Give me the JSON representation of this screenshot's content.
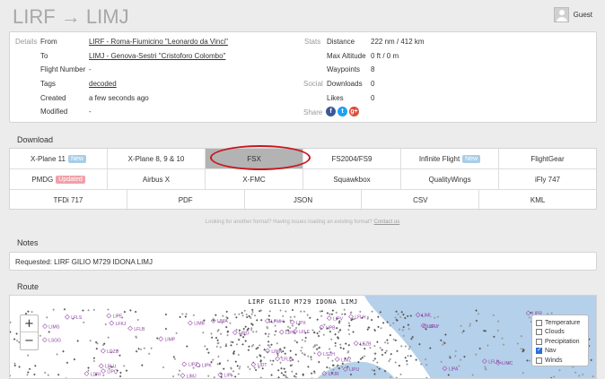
{
  "header": {
    "title": "LIRF → LIMJ",
    "user": "Guest"
  },
  "details": {
    "section": "Details",
    "from_label": "From",
    "from_value": "LIRF - Roma-Fiumicino \"Leonardo da Vinci\"",
    "to_label": "To",
    "to_value": "LIMJ - Genova-Sestri \"Cristoforo Colombo\"",
    "flight_label": "Flight Number",
    "flight_value": "-",
    "tags_label": "Tags",
    "tags_value": "decoded",
    "created_label": "Created",
    "created_value": "a few seconds ago",
    "modified_label": "Modified",
    "modified_value": "-"
  },
  "stats": {
    "section": "Stats",
    "distance_label": "Distance",
    "distance_value": "222 nm / 412 km",
    "altitude_label": "Max Altitude",
    "altitude_value": "0 ft / 0 m",
    "waypoints_label": "Waypoints",
    "waypoints_value": "8"
  },
  "social": {
    "section": "Social",
    "downloads_label": "Downloads",
    "downloads_value": "0",
    "likes_label": "Likes",
    "likes_value": "0",
    "share_label": "Share",
    "share_icons": [
      {
        "name": "facebook-icon",
        "glyph": "f",
        "color": "#3b5998"
      },
      {
        "name": "twitter-icon",
        "glyph": "t",
        "color": "#1da1f2"
      },
      {
        "name": "google-plus-icon",
        "glyph": "g+",
        "color": "#dd4b39"
      }
    ]
  },
  "download": {
    "section": "Download",
    "rows": [
      [
        {
          "label": "X-Plane 11",
          "badge": "New",
          "badge_type": "new"
        },
        {
          "label": "X-Plane 8, 9 & 10"
        },
        {
          "label": "FSX",
          "active": true
        },
        {
          "label": "FS2004/FS9"
        },
        {
          "label": "Infinite Flight",
          "badge": "New",
          "badge_type": "new"
        },
        {
          "label": "FlightGear"
        }
      ],
      [
        {
          "label": "PMDG",
          "badge": "Updated",
          "badge_type": "upd"
        },
        {
          "label": "Airbus X"
        },
        {
          "label": "X-FMC"
        },
        {
          "label": "Squawkbox"
        },
        {
          "label": "QualityWings"
        },
        {
          "label": "iFly 747"
        }
      ],
      [
        {
          "label": "TFDi 717"
        },
        {
          "label": "PDF"
        },
        {
          "label": "JSON"
        },
        {
          "label": "CSV"
        },
        {
          "label": "KML"
        }
      ]
    ],
    "help_text": "Looking for another format? Having issues loading an existing format?",
    "help_link": "Contact us"
  },
  "notes": {
    "section": "Notes",
    "text": "Requested: LIRF GILIO M729 IDONA LIMJ"
  },
  "route": {
    "section": "Route",
    "map_title": "LIRF GILIO M729 IDONA LIMJ",
    "zoom_in": "+",
    "zoom_out": "−",
    "layers": [
      {
        "label": "Temperature",
        "checked": false
      },
      {
        "label": "Clouds",
        "checked": false
      },
      {
        "label": "Precipitation",
        "checked": false
      },
      {
        "label": "Nav",
        "checked": true
      },
      {
        "label": "Winds",
        "checked": false
      }
    ],
    "map_labels": [
      "LFLG",
      "LFLH",
      "LFLU",
      "LFLB",
      "LFLE",
      "LFMH",
      "LFLY",
      "LFLS",
      "LFLN",
      "LFJR",
      "LIMZ",
      "LIML",
      "LIMC",
      "LIMN",
      "LIPO",
      "LIPE",
      "LIPR",
      "LIPQ",
      "LIPV",
      "LIPH",
      "LIMB",
      "LIPB",
      "LIPK",
      "LIMP",
      "LIDT",
      "LIPA",
      "LIMJ",
      "LIPX",
      "LIPZ",
      "LIDU",
      "LDZU",
      "LDRI",
      "LSGG",
      "LSZB",
      "LSZH",
      "LIPI",
      "LIMA",
      "LIMG",
      "LFKJ",
      "LIPU"
    ]
  }
}
